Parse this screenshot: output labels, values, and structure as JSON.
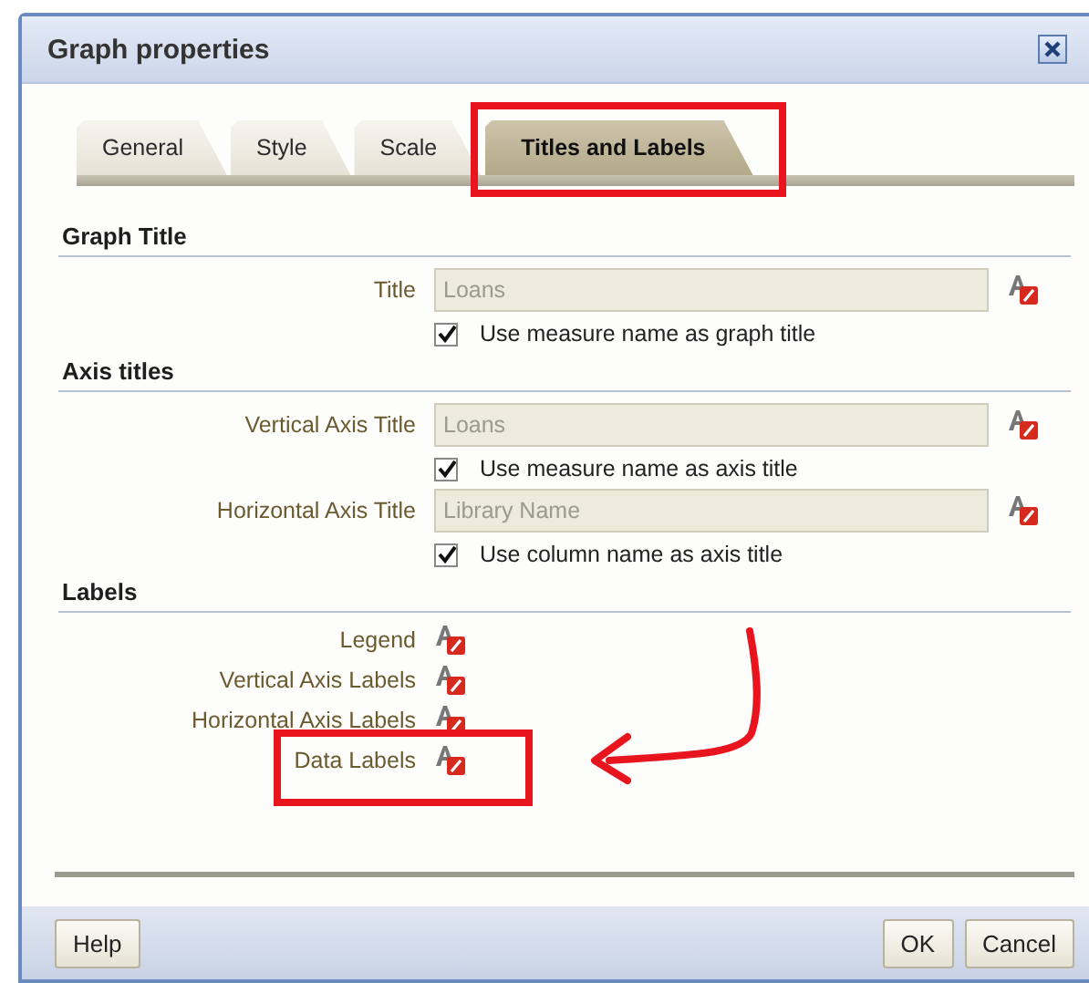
{
  "window": {
    "title": "Graph properties"
  },
  "tabs": [
    {
      "label": "General",
      "selected": false,
      "highlighted": false
    },
    {
      "label": "Style",
      "selected": false,
      "highlighted": false
    },
    {
      "label": "Scale",
      "selected": false,
      "highlighted": false
    },
    {
      "label": "Titles and Labels",
      "selected": true,
      "highlighted": true
    }
  ],
  "sections": [
    {
      "heading": "Graph Title",
      "rows": [
        {
          "kind": "field",
          "label": "Title",
          "value": "Loans",
          "disabled": true,
          "option": {
            "label": "Use measure name as graph title",
            "checked": true
          }
        }
      ]
    },
    {
      "heading": "Axis titles",
      "rows": [
        {
          "kind": "field",
          "label": "Vertical Axis Title",
          "value": "Loans",
          "disabled": true,
          "option": {
            "label": "Use measure name as axis title",
            "checked": true
          }
        },
        {
          "kind": "field",
          "label": "Horizontal Axis Title",
          "value": "Library Name",
          "disabled": true,
          "option": {
            "label": "Use column name as axis title",
            "checked": true
          }
        }
      ]
    },
    {
      "heading": "Labels",
      "rows": [
        {
          "kind": "format",
          "label": "Legend",
          "highlighted": false
        },
        {
          "kind": "format",
          "label": "Vertical Axis Labels",
          "highlighted": false
        },
        {
          "kind": "format",
          "label": "Horizontal Axis Labels",
          "highlighted": false
        },
        {
          "kind": "format",
          "label": "Data Labels",
          "highlighted": true
        }
      ]
    }
  ],
  "footer": {
    "left": [
      "Help"
    ],
    "right": [
      "OK",
      "Cancel"
    ]
  }
}
